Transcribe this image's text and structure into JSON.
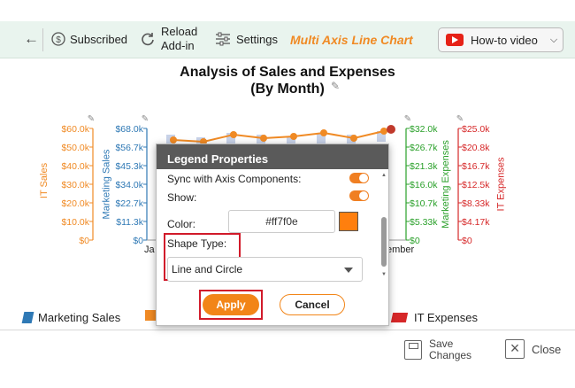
{
  "toolbar": {
    "subscribed_label": "Subscribed",
    "reload_label_line1": "Reload",
    "reload_label_line2": "Add-in",
    "settings_label": "Settings",
    "brand_label": "Multi Axis Line Chart",
    "howto_label": "How-to video"
  },
  "chart": {
    "title_line1": "Analysis of Sales and Expenses",
    "title_line2": "(By Month)",
    "x_label_left_fragment": "Ja",
    "x_label_right_fragment": "ember"
  },
  "chart_data": {
    "type": "line",
    "title": "Analysis of Sales and Expenses (By Month)",
    "axes": [
      {
        "name": "IT Sales",
        "color": "#f08a24",
        "side": "left",
        "ticks": [
          "$60.0k",
          "$50.0k",
          "$40.0k",
          "$30.0k",
          "$20.0k",
          "$10.0k",
          "$0"
        ]
      },
      {
        "name": "Marketing Sales",
        "color": "#2f79b5",
        "side": "left",
        "ticks": [
          "$68.0k",
          "$56.7k",
          "$45.3k",
          "$34.0k",
          "$22.7k",
          "$11.3k",
          "$0"
        ]
      },
      {
        "name": "Marketing Expenses",
        "color": "#2aa02a",
        "side": "right",
        "ticks": [
          "$32.0k",
          "$26.7k",
          "$21.3k",
          "$16.0k",
          "$10.7k",
          "$5.33k",
          "$0"
        ]
      },
      {
        "name": "IT Expenses",
        "color": "#d62728",
        "side": "right",
        "ticks": [
          "$25.0k",
          "$20.8k",
          "$16.7k",
          "$12.5k",
          "$8.33k",
          "$4.17k",
          "$0"
        ]
      }
    ]
  },
  "legend": {
    "marketing_sales": "Marketing Sales",
    "it_expenses": "IT Expenses"
  },
  "dialog": {
    "title": "Legend Properties",
    "sync_label": "Sync with Axis Components:",
    "show_label": "Show:",
    "color_label": "Color:",
    "color_value": "#ff7f0e",
    "shape_label": "Shape Type:",
    "shape_value": "Line and Circle",
    "apply_label": "Apply",
    "cancel_label": "Cancel"
  },
  "footer": {
    "save_line1": "Save",
    "save_line2": "Changes",
    "close_label": "Close"
  },
  "colors": {
    "accent": "#f28518",
    "highlight": "#d11a2a",
    "series_color": "#ff7f0e"
  }
}
